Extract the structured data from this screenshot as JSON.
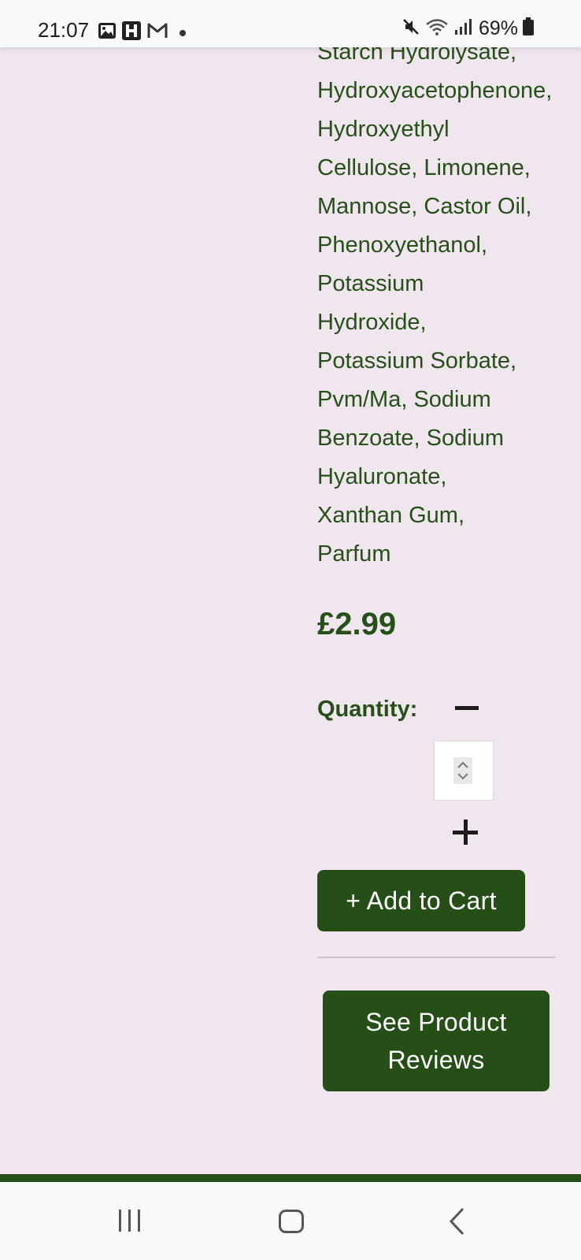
{
  "status_bar": {
    "time": "21:07",
    "battery": "69%",
    "icons_left": [
      "gallery-icon",
      "h-app-icon",
      "gmail-icon",
      "notification-dot"
    ],
    "icons_right": [
      "mute-icon",
      "wifi-icon",
      "signal-icon",
      "battery-icon"
    ]
  },
  "product": {
    "ingredients": "Starch Hydrolysate,\nHydroxyacetophenone,\nHydroxyethyl\nCellulose, Limonene,\nMannose, Castor Oil,\nPhenoxyethanol,\nPotassium\nHydroxide,\nPotassium Sorbate,\nPvm/Ma, Sodium\nBenzoate, Sodium\nHyaluronate,\nXanthan Gum,\nParfum",
    "price": "£2.99",
    "quantity_label": "Quantity:",
    "quantity_value": "",
    "add_to_cart_label": "+ Add to Cart",
    "reviews_label": "See Product Reviews"
  },
  "colors": {
    "brand_green": "#264f18",
    "text_green": "#274f19",
    "background": "#efe6ee"
  },
  "nav_bar": {
    "icons": [
      "recents-icon",
      "home-icon",
      "back-icon"
    ]
  }
}
